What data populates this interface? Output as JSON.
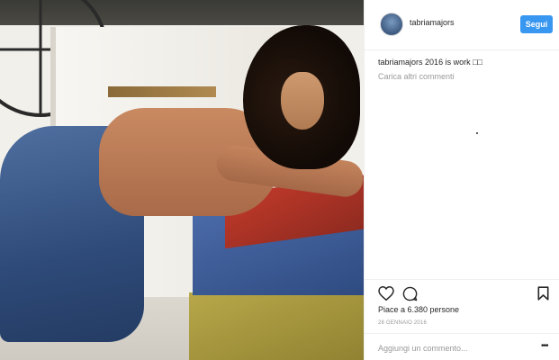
{
  "post": {
    "username": "tabriamajors",
    "follow_label": "Segui",
    "caption_user": "tabriamajors",
    "caption_text": "2016 is work □□",
    "load_more": "Carica altri commenti",
    "likes": "Piace a 6.380 persone",
    "date": "28 GENNAIO 2016",
    "comment_placeholder": "Aggiungi un commento...",
    "more": "•••"
  },
  "icons": {
    "like": "heart-icon",
    "comment": "comment-icon",
    "save": "bookmark-icon",
    "options": "more-options-icon"
  },
  "colors": {
    "follow_button": "#3897f0",
    "text": "#262626",
    "muted": "#999999",
    "divider": "#efefef"
  }
}
